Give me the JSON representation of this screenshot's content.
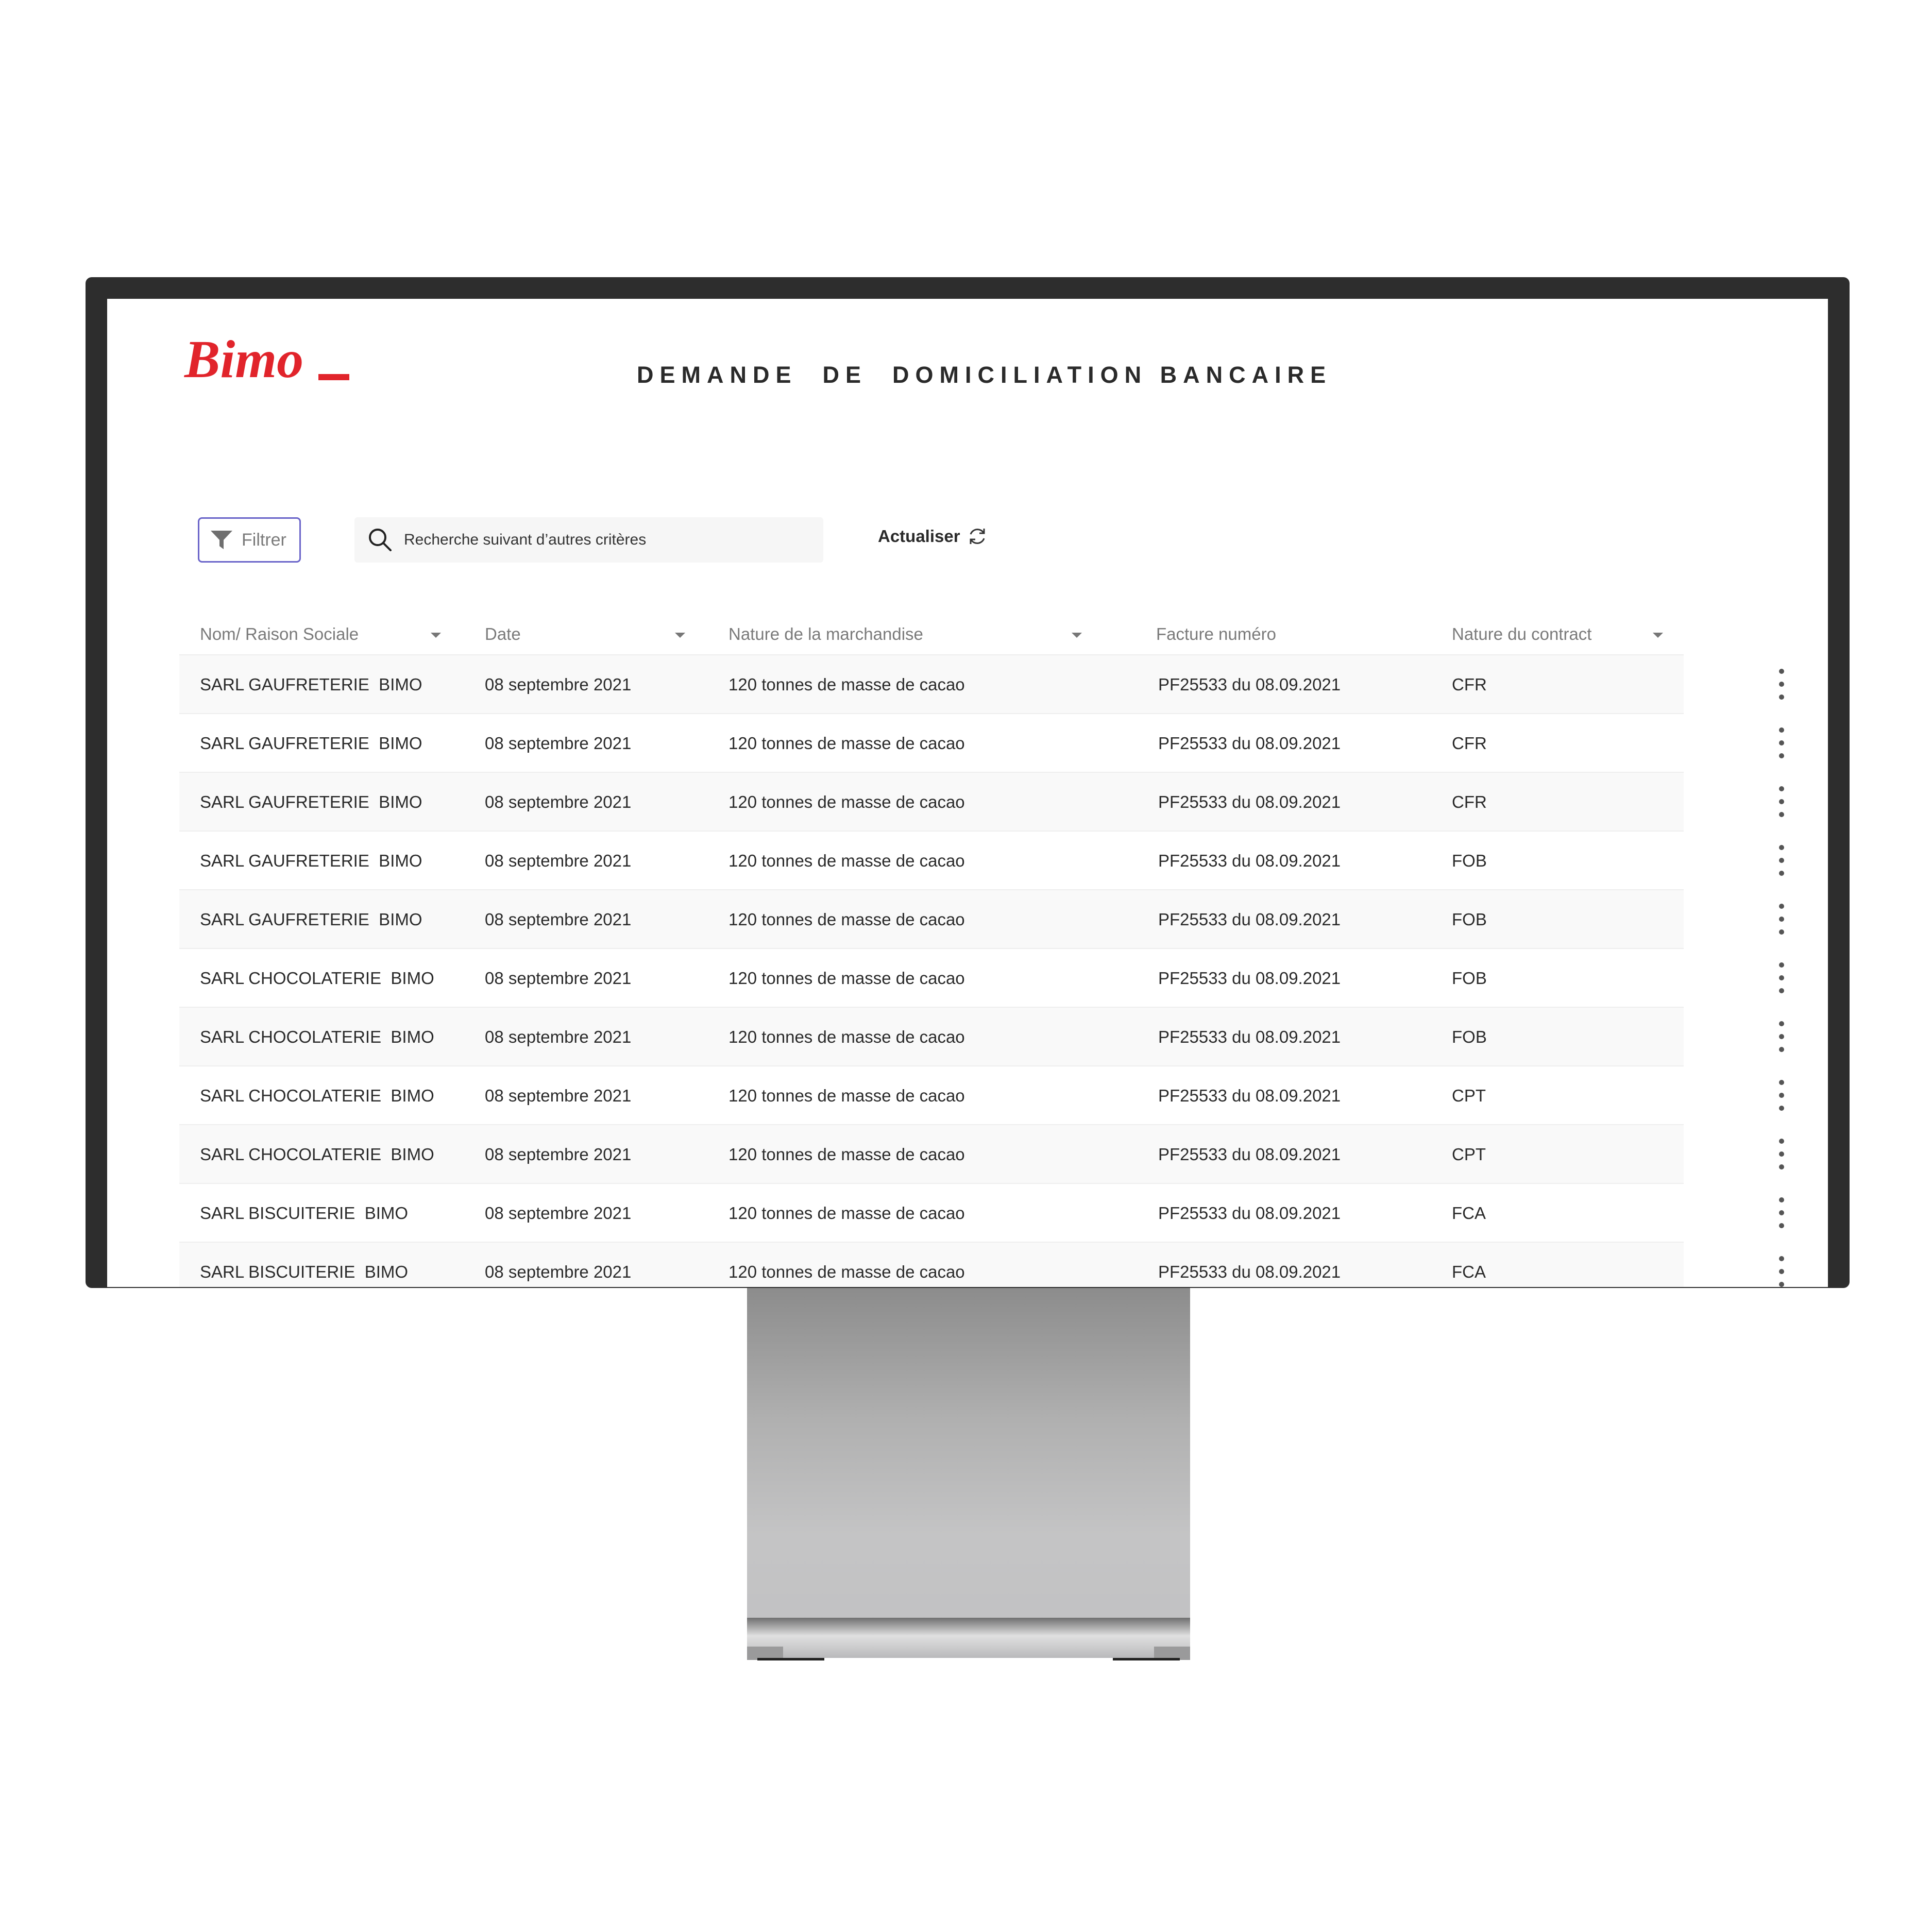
{
  "app": {
    "title": "DEMANDE  DE  DOMICILIATION BANCAIRE",
    "logo_text": "Bimo",
    "brand_color": "#e1242b"
  },
  "toolbar": {
    "filter_label": "Filtrer",
    "filter_icon": "funnel-icon",
    "search_placeholder": "Recherche suivant d’autres critères",
    "search_icon": "search-icon",
    "refresh_label": "Actualiser",
    "refresh_icon": "refresh-icon",
    "accent_color": "#6a64c9"
  },
  "table": {
    "columns": [
      {
        "label": "Nom/ Raison Sociale",
        "sortable": true
      },
      {
        "label": "Date",
        "sortable": true
      },
      {
        "label": "Nature de la marchandise",
        "sortable": true
      },
      {
        "label": "Facture numéro",
        "sortable": false
      },
      {
        "label": "Nature du contract",
        "sortable": true
      }
    ],
    "rows": [
      {
        "name": "SARL GAUFRETERIE  BIMO",
        "date": "08 septembre 2021",
        "goods": "120 tonnes de masse de cacao",
        "invoice": "PF25533 du 08.09.2021",
        "contract": "CFR"
      },
      {
        "name": "SARL GAUFRETERIE  BIMO",
        "date": "08 septembre 2021",
        "goods": "120 tonnes de masse de cacao",
        "invoice": "PF25533 du 08.09.2021",
        "contract": "CFR"
      },
      {
        "name": "SARL GAUFRETERIE  BIMO",
        "date": "08 septembre 2021",
        "goods": "120 tonnes de masse de cacao",
        "invoice": "PF25533 du 08.09.2021",
        "contract": "CFR"
      },
      {
        "name": "SARL GAUFRETERIE  BIMO",
        "date": "08 septembre 2021",
        "goods": "120 tonnes de masse de cacao",
        "invoice": "PF25533 du 08.09.2021",
        "contract": "FOB"
      },
      {
        "name": "SARL GAUFRETERIE  BIMO",
        "date": "08 septembre 2021",
        "goods": "120 tonnes de masse de cacao",
        "invoice": "PF25533 du 08.09.2021",
        "contract": "FOB"
      },
      {
        "name": "SARL CHOCOLATERIE  BIMO",
        "date": "08 septembre 2021",
        "goods": "120 tonnes de masse de cacao",
        "invoice": "PF25533 du 08.09.2021",
        "contract": "FOB"
      },
      {
        "name": "SARL CHOCOLATERIE  BIMO",
        "date": "08 septembre 2021",
        "goods": "120 tonnes de masse de cacao",
        "invoice": "PF25533 du 08.09.2021",
        "contract": "FOB"
      },
      {
        "name": "SARL CHOCOLATERIE  BIMO",
        "date": "08 septembre 2021",
        "goods": "120 tonnes de masse de cacao",
        "invoice": "PF25533 du 08.09.2021",
        "contract": "CPT"
      },
      {
        "name": "SARL CHOCOLATERIE  BIMO",
        "date": "08 septembre 2021",
        "goods": "120 tonnes de masse de cacao",
        "invoice": "PF25533 du 08.09.2021",
        "contract": "CPT"
      },
      {
        "name": "SARL BISCUITERIE  BIMO",
        "date": "08 septembre 2021",
        "goods": "120 tonnes de masse de cacao",
        "invoice": "PF25533 du 08.09.2021",
        "contract": "FCA"
      },
      {
        "name": "SARL BISCUITERIE  BIMO",
        "date": "08 septembre 2021",
        "goods": "120 tonnes de masse de cacao",
        "invoice": "PF25533 du 08.09.2021",
        "contract": "FCA"
      }
    ]
  }
}
